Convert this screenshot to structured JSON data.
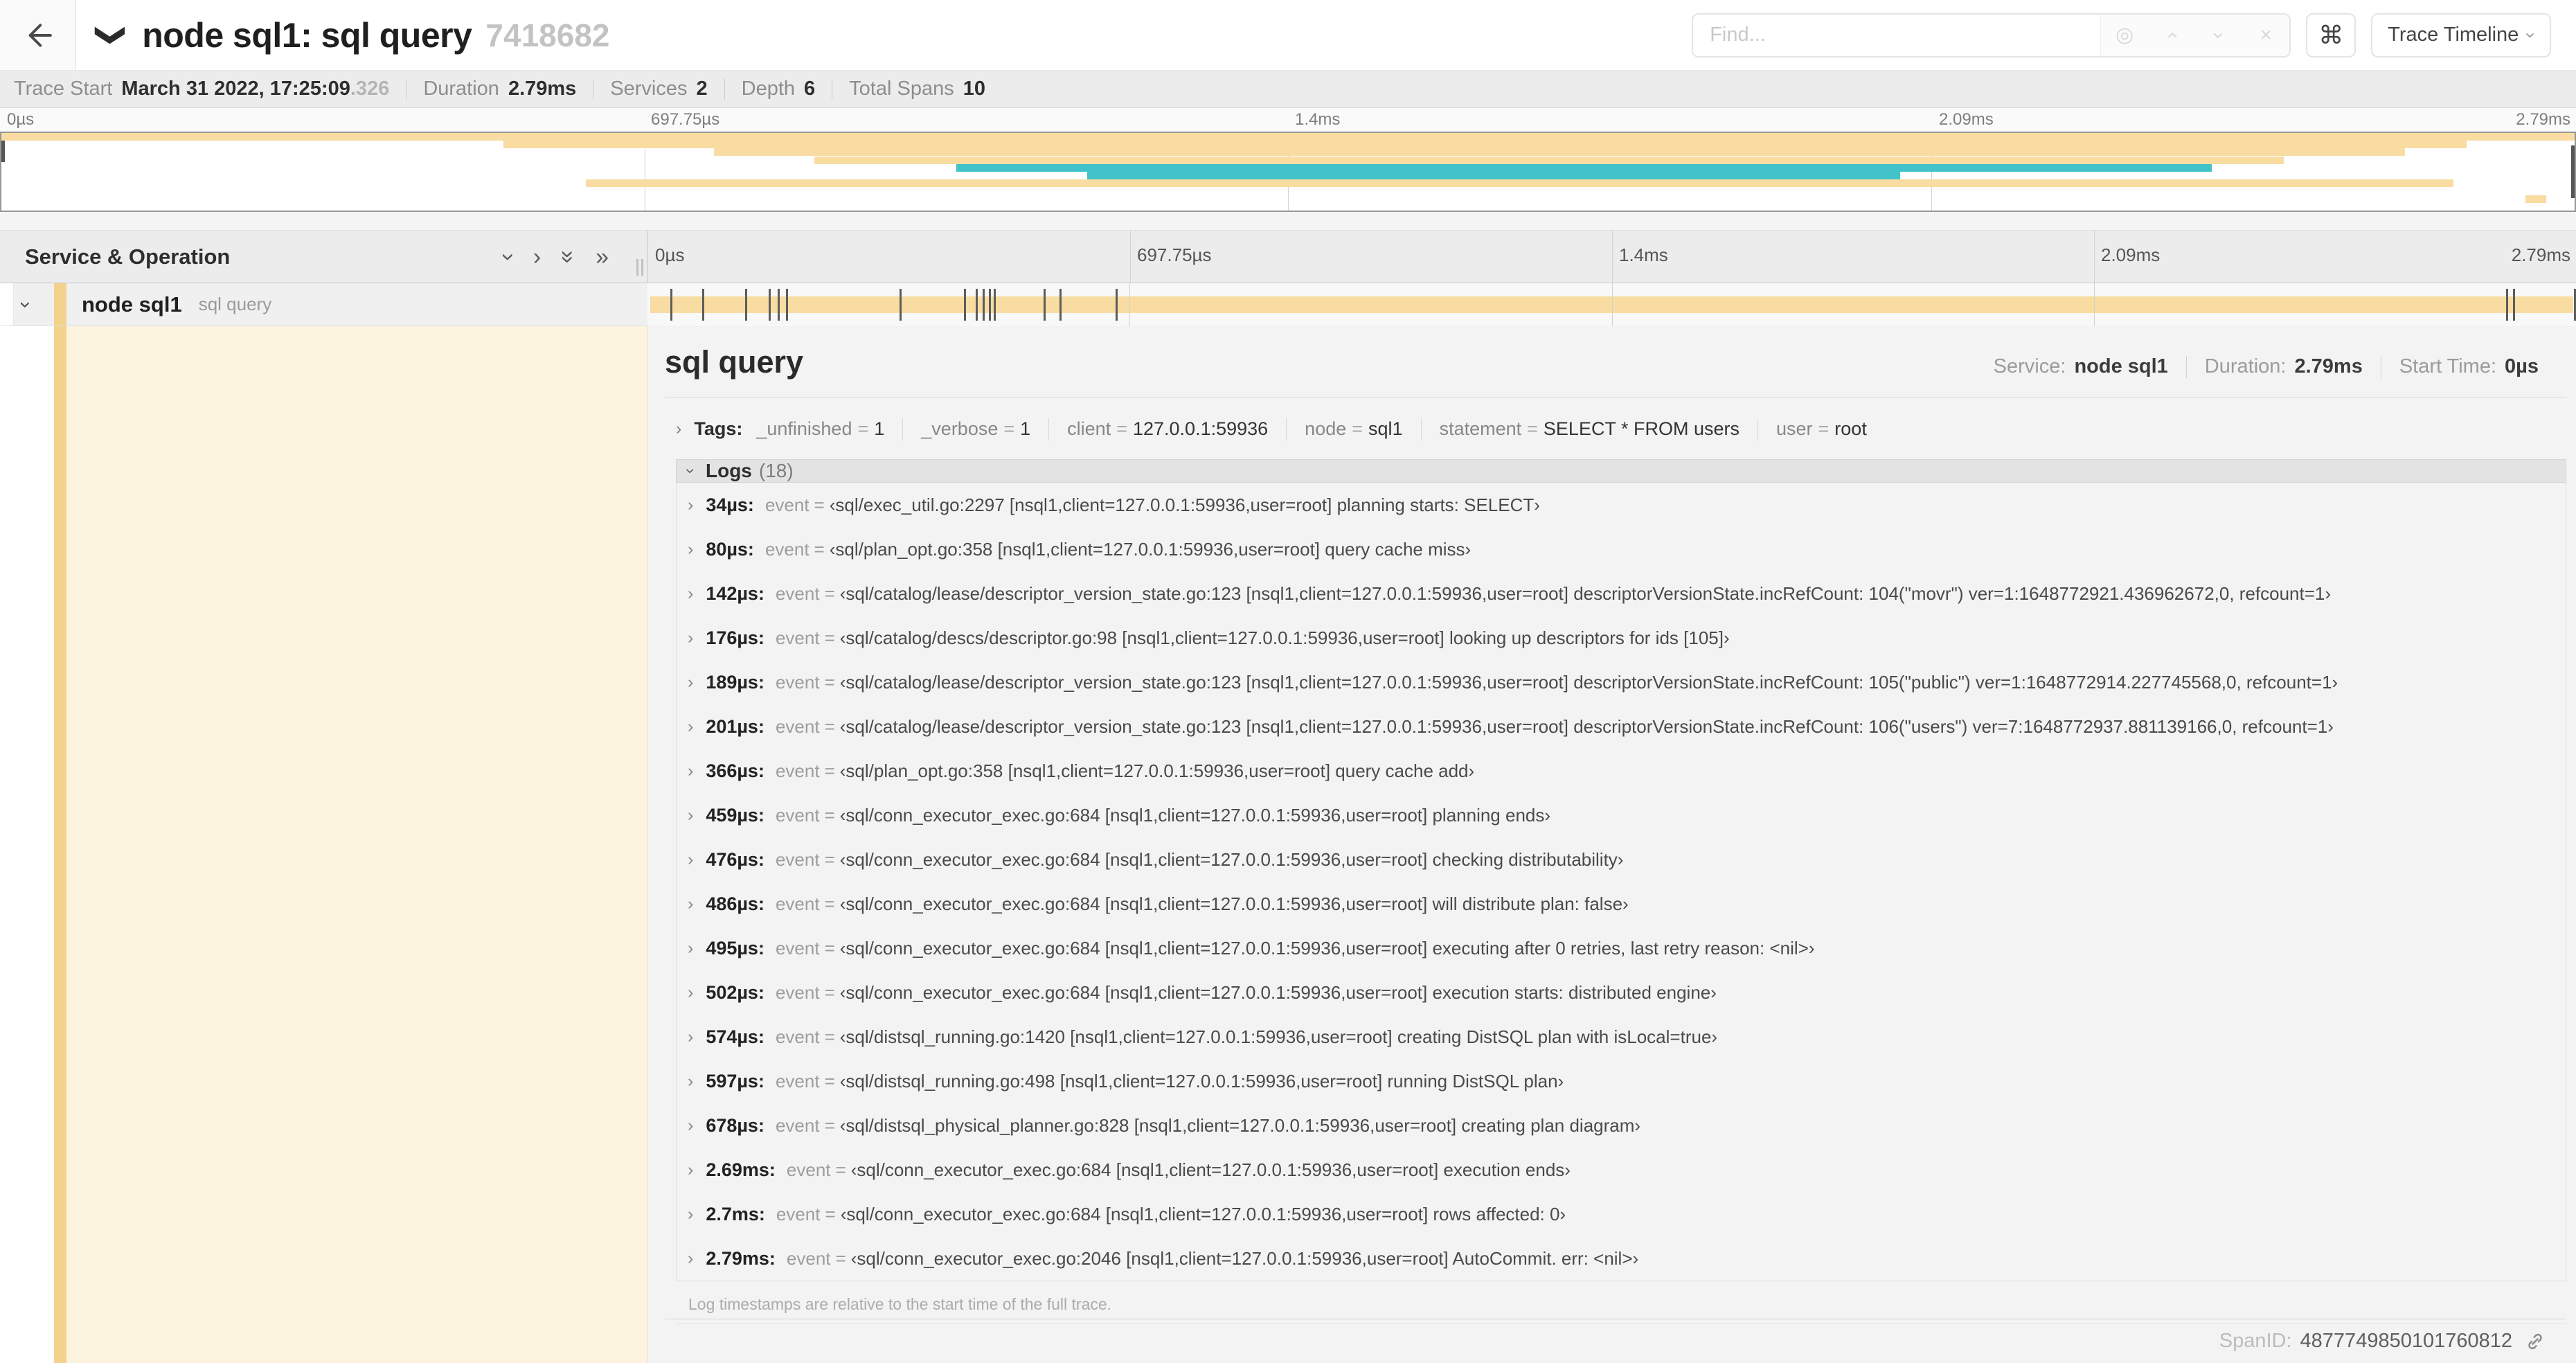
{
  "header": {
    "back_icon": "←",
    "title": "node sql1: sql query",
    "title_id": "7418682",
    "find_placeholder": "Find...",
    "icons": {
      "target": "◎",
      "prev": "›",
      "next": "›",
      "clear": "×",
      "keyboard": "⌘",
      "dropdown": "›"
    },
    "view_selector_label": "Trace Timeline"
  },
  "summary": {
    "items": [
      {
        "label": "Trace Start",
        "value": "March 31 2022, 17:25:09",
        "suffix": ".326"
      },
      {
        "label": "Duration",
        "value": "2.79ms"
      },
      {
        "label": "Services",
        "value": "2"
      },
      {
        "label": "Depth",
        "value": "6"
      },
      {
        "label": "Total Spans",
        "value": "10"
      }
    ]
  },
  "timeline": {
    "ticks": [
      "0µs",
      "697.75µs",
      "1.4ms",
      "2.09ms",
      "2.79ms"
    ],
    "duration_us": 2790,
    "minimap_spans": [
      {
        "row": 0,
        "color": "tan",
        "start": 0.0,
        "end": 1.0
      },
      {
        "row": 1,
        "color": "tan",
        "start": 0.195,
        "end": 0.958
      },
      {
        "row": 2,
        "color": "tan",
        "start": 0.277,
        "end": 0.934
      },
      {
        "row": 3,
        "color": "tan",
        "start": 0.316,
        "end": 0.887
      },
      {
        "row": 4,
        "color": "teal",
        "start": 0.371,
        "end": 0.859
      },
      {
        "row": 5,
        "color": "teal",
        "start": 0.422,
        "end": 0.738
      },
      {
        "row": 6,
        "color": "tan",
        "start": 0.227,
        "end": 0.953
      },
      {
        "row": 8,
        "color": "tan",
        "start": 0.981,
        "end": 0.989
      }
    ],
    "span_markers_us": [
      34,
      80,
      142,
      176,
      189,
      201,
      366,
      459,
      476,
      486,
      495,
      502,
      574,
      597,
      678,
      2690,
      2700,
      2788
    ]
  },
  "tree": {
    "column_title": "Service & Operation",
    "row": {
      "service": "node sql1",
      "operation": "sql query"
    }
  },
  "detail": {
    "operation": "sql query",
    "meta": [
      {
        "label": "Service:",
        "value": "node sql1"
      },
      {
        "label": "Duration:",
        "value": "2.79ms"
      },
      {
        "label": "Start Time:",
        "value": "0µs"
      }
    ],
    "tags_label": "Tags:",
    "tags": [
      {
        "key": "_unfinished",
        "value": "1"
      },
      {
        "key": "_verbose",
        "value": "1"
      },
      {
        "key": "client",
        "value": "127.0.0.1:59936"
      },
      {
        "key": "node",
        "value": "sql1"
      },
      {
        "key": "statement",
        "value": "SELECT * FROM users"
      },
      {
        "key": "user",
        "value": "root"
      }
    ],
    "logs_label": "Logs",
    "logs_count": "(18)",
    "log_key": "event",
    "logs": [
      {
        "t": "34µs:",
        "value": "‹sql/exec_util.go:2297 [nsql1,client=127.0.0.1:59936,user=root] planning starts: SELECT›"
      },
      {
        "t": "80µs:",
        "value": "‹sql/plan_opt.go:358 [nsql1,client=127.0.0.1:59936,user=root] query cache miss›"
      },
      {
        "t": "142µs:",
        "value": "‹sql/catalog/lease/descriptor_version_state.go:123 [nsql1,client=127.0.0.1:59936,user=root] descriptorVersionState.incRefCount: 104(\"movr\") ver=1:1648772921.436962672,0, refcount=1›"
      },
      {
        "t": "176µs:",
        "value": "‹sql/catalog/descs/descriptor.go:98 [nsql1,client=127.0.0.1:59936,user=root] looking up descriptors for ids [105]›"
      },
      {
        "t": "189µs:",
        "value": "‹sql/catalog/lease/descriptor_version_state.go:123 [nsql1,client=127.0.0.1:59936,user=root] descriptorVersionState.incRefCount: 105(\"public\") ver=1:1648772914.227745568,0, refcount=1›"
      },
      {
        "t": "201µs:",
        "value": "‹sql/catalog/lease/descriptor_version_state.go:123 [nsql1,client=127.0.0.1:59936,user=root] descriptorVersionState.incRefCount: 106(\"users\") ver=7:1648772937.881139166,0, refcount=1›"
      },
      {
        "t": "366µs:",
        "value": "‹sql/plan_opt.go:358 [nsql1,client=127.0.0.1:59936,user=root] query cache add›"
      },
      {
        "t": "459µs:",
        "value": "‹sql/conn_executor_exec.go:684 [nsql1,client=127.0.0.1:59936,user=root] planning ends›"
      },
      {
        "t": "476µs:",
        "value": "‹sql/conn_executor_exec.go:684 [nsql1,client=127.0.0.1:59936,user=root] checking distributability›"
      },
      {
        "t": "486µs:",
        "value": "‹sql/conn_executor_exec.go:684 [nsql1,client=127.0.0.1:59936,user=root] will distribute plan: false›"
      },
      {
        "t": "495µs:",
        "value": "‹sql/conn_executor_exec.go:684 [nsql1,client=127.0.0.1:59936,user=root] executing after 0 retries, last retry reason: <nil>›"
      },
      {
        "t": "502µs:",
        "value": "‹sql/conn_executor_exec.go:684 [nsql1,client=127.0.0.1:59936,user=root] execution starts: distributed engine›"
      },
      {
        "t": "574µs:",
        "value": "‹sql/distsql_running.go:1420 [nsql1,client=127.0.0.1:59936,user=root] creating DistSQL plan with isLocal=true›"
      },
      {
        "t": "597µs:",
        "value": "‹sql/distsql_running.go:498 [nsql1,client=127.0.0.1:59936,user=root] running DistSQL plan›"
      },
      {
        "t": "678µs:",
        "value": "‹sql/distsql_physical_planner.go:828 [nsql1,client=127.0.0.1:59936,user=root] creating plan diagram›"
      },
      {
        "t": "2.69ms:",
        "value": "‹sql/conn_executor_exec.go:684 [nsql1,client=127.0.0.1:59936,user=root] execution ends›"
      },
      {
        "t": "2.7ms:",
        "value": "‹sql/conn_executor_exec.go:684 [nsql1,client=127.0.0.1:59936,user=root] rows affected: 0›"
      },
      {
        "t": "2.79ms:",
        "value": "‹sql/conn_executor_exec.go:2046 [nsql1,client=127.0.0.1:59936,user=root] AutoCommit. err: <nil>›"
      }
    ],
    "note": "Log timestamps are relative to the start time of the full trace.",
    "span_id_label": "SpanID:",
    "span_id": "4877749850101760812"
  },
  "colors": {
    "tan": "#f8dca1",
    "teal": "#41c3c9",
    "strip": "#f2d28c",
    "cream": "#fcf3df"
  }
}
